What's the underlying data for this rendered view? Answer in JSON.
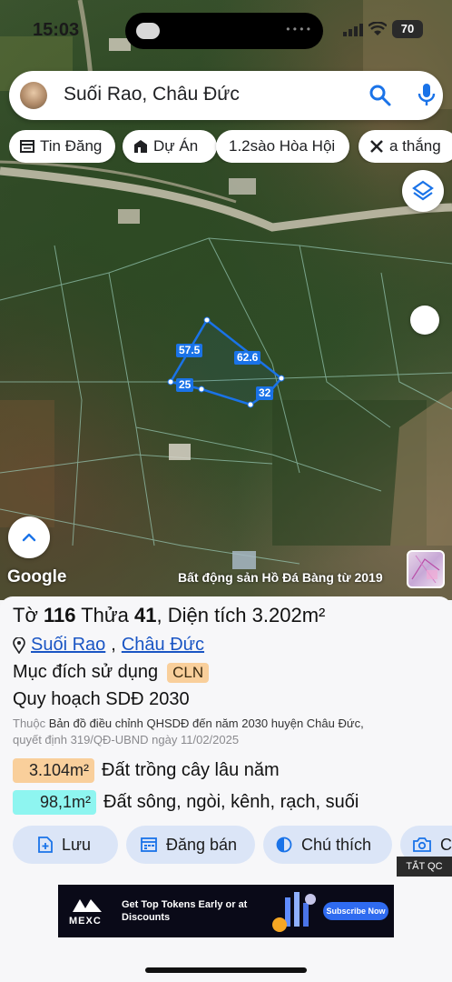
{
  "status_bar": {
    "time": "15:03",
    "battery": "70"
  },
  "search": {
    "query": "Suối Rao, Châu Đức"
  },
  "chips": [
    {
      "label": "Tin Đăng",
      "icon": "listing-icon"
    },
    {
      "label": "Dự Án",
      "icon": "building-icon"
    },
    {
      "label": "1.2sào Hòa Hội",
      "icon": ""
    },
    {
      "label": "a thắng",
      "icon": "tools-icon"
    }
  ],
  "map": {
    "google_logo": "Google",
    "attribution": "Bất động sản Hồ Đá Bàng từ 2019",
    "parcel_edges": [
      "57.5",
      "62.6",
      "25",
      "32"
    ]
  },
  "parcel": {
    "to_label": "Tờ",
    "to_value": "116",
    "thua_label": "Thửa",
    "thua_value": "41",
    "area_label": "Diện tích",
    "area_value": "3.202m²",
    "location": {
      "commune": "Suối Rao",
      "district": "Châu Đức",
      "separator": ","
    },
    "purpose_label": "Mục đích sử dụng",
    "purpose_code": "CLN",
    "plan_label": "Quy hoạch SDĐ 2030",
    "note_prefix": "Thuộc",
    "note_link": "Bản đồ điều chỉnh QHSDĐ đến năm 2030 huyện Châu Đức,",
    "note_rest": "quyết định 319/QĐ-UBND ngày 11/02/2025",
    "areas": [
      {
        "value": "3.104m²",
        "desc": "Đất trồng cây lâu năm",
        "color": "#f9cf9b"
      },
      {
        "value": "98,1m²",
        "desc": "Đất sông, ngòi, kênh, rạch, suối",
        "color": "#8ef5f0"
      }
    ]
  },
  "actions": [
    {
      "label": "Lưu",
      "icon": "save-icon"
    },
    {
      "label": "Đăng bán",
      "icon": "calendar-icon"
    },
    {
      "label": "Chú thích",
      "icon": "contrast-icon"
    },
    {
      "label": "C",
      "icon": "camera-icon"
    }
  ],
  "ad": {
    "close_label": "TẮT QC",
    "brand": "MEXC",
    "headline": "Get Top Tokens Early or at Discounts",
    "cta": "Subscribe Now"
  },
  "colors": {
    "accent": "#1a73e8",
    "sheet_bg": "#f7f7f9",
    "chip_bg": "#dbe5f7"
  }
}
